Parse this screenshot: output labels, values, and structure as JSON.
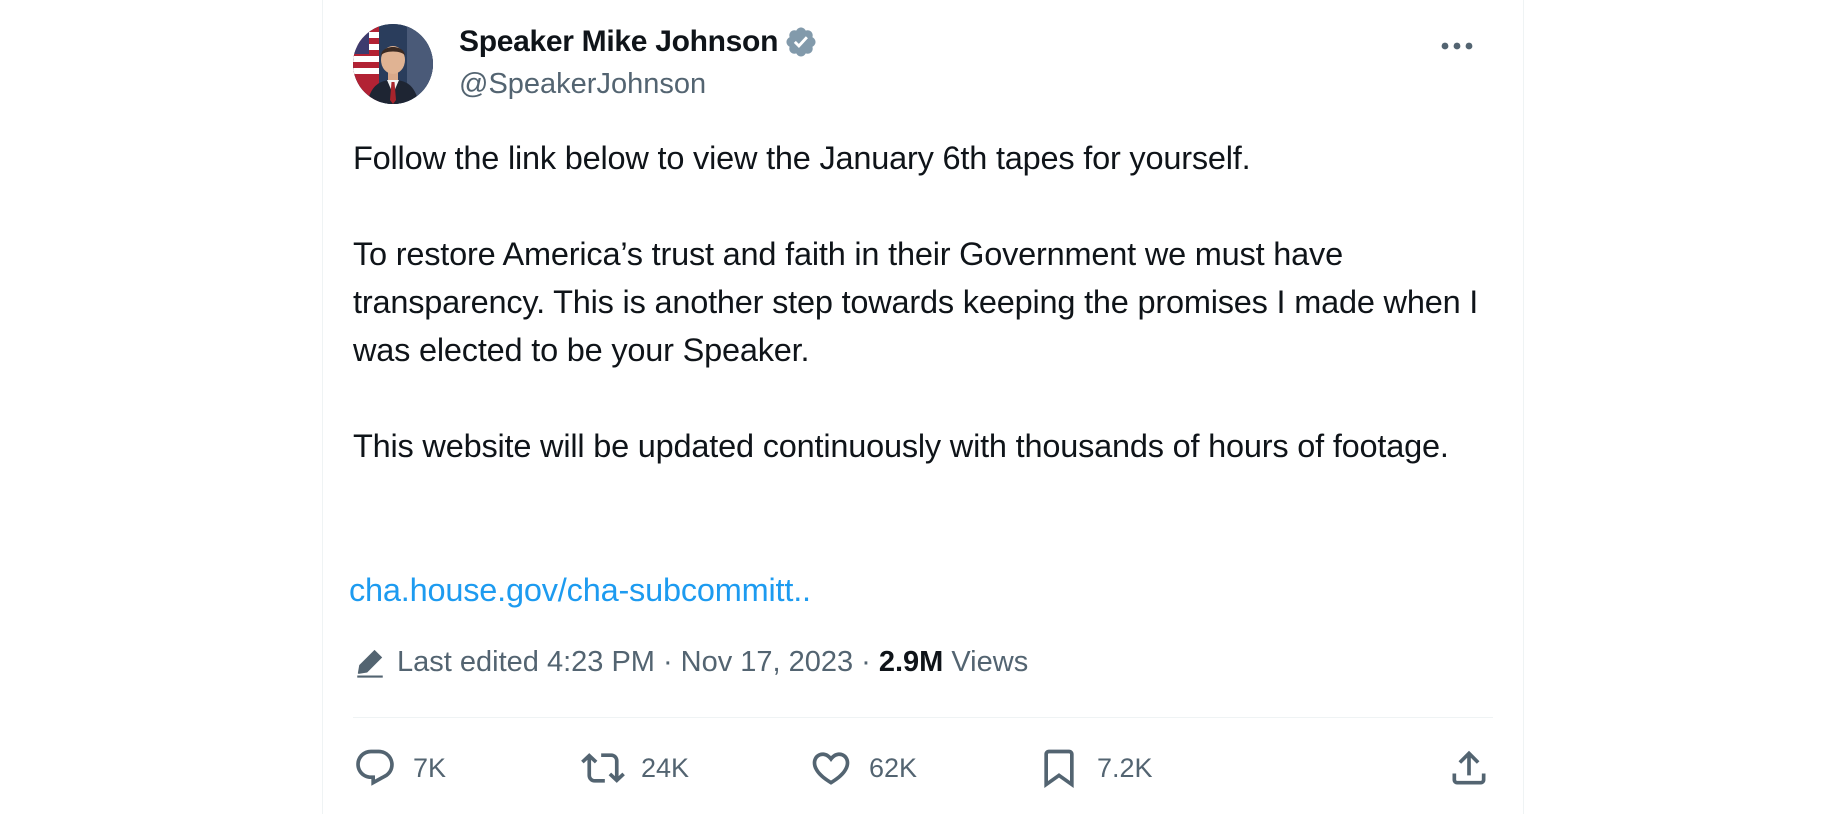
{
  "author": {
    "display_name": "Speaker Mike Johnson",
    "handle": "@SpeakerJohnson",
    "verified_icon": "verified-badge-icon",
    "avatar_icon": "profile-photo"
  },
  "tweet": {
    "paragraphs": [
      "Follow the link below to view the January 6th tapes for yourself.",
      "To restore America’s trust and faith in their Government we must have transparency. This is another step towards keeping the promises I made when I was elected to be your Speaker.",
      "This website will be updated continuously with thousands of hours of footage."
    ],
    "link_text": "cha.house.gov/cha-subcommitt..",
    "edited_label": "Last edited",
    "timestamp_time": "4:23 PM",
    "timestamp_date": "Nov 17, 2023",
    "separator": "·",
    "views_count": "2.9M",
    "views_label": "Views"
  },
  "actions": {
    "reply_count": "7K",
    "retweet_count": "24K",
    "like_count": "62K",
    "bookmark_count": "7.2K"
  },
  "colors": {
    "link": "#1d9bf0",
    "verified": "#829aab",
    "secondary_text": "#536471",
    "primary_text": "#0f1419",
    "divider": "#eff3f4"
  }
}
